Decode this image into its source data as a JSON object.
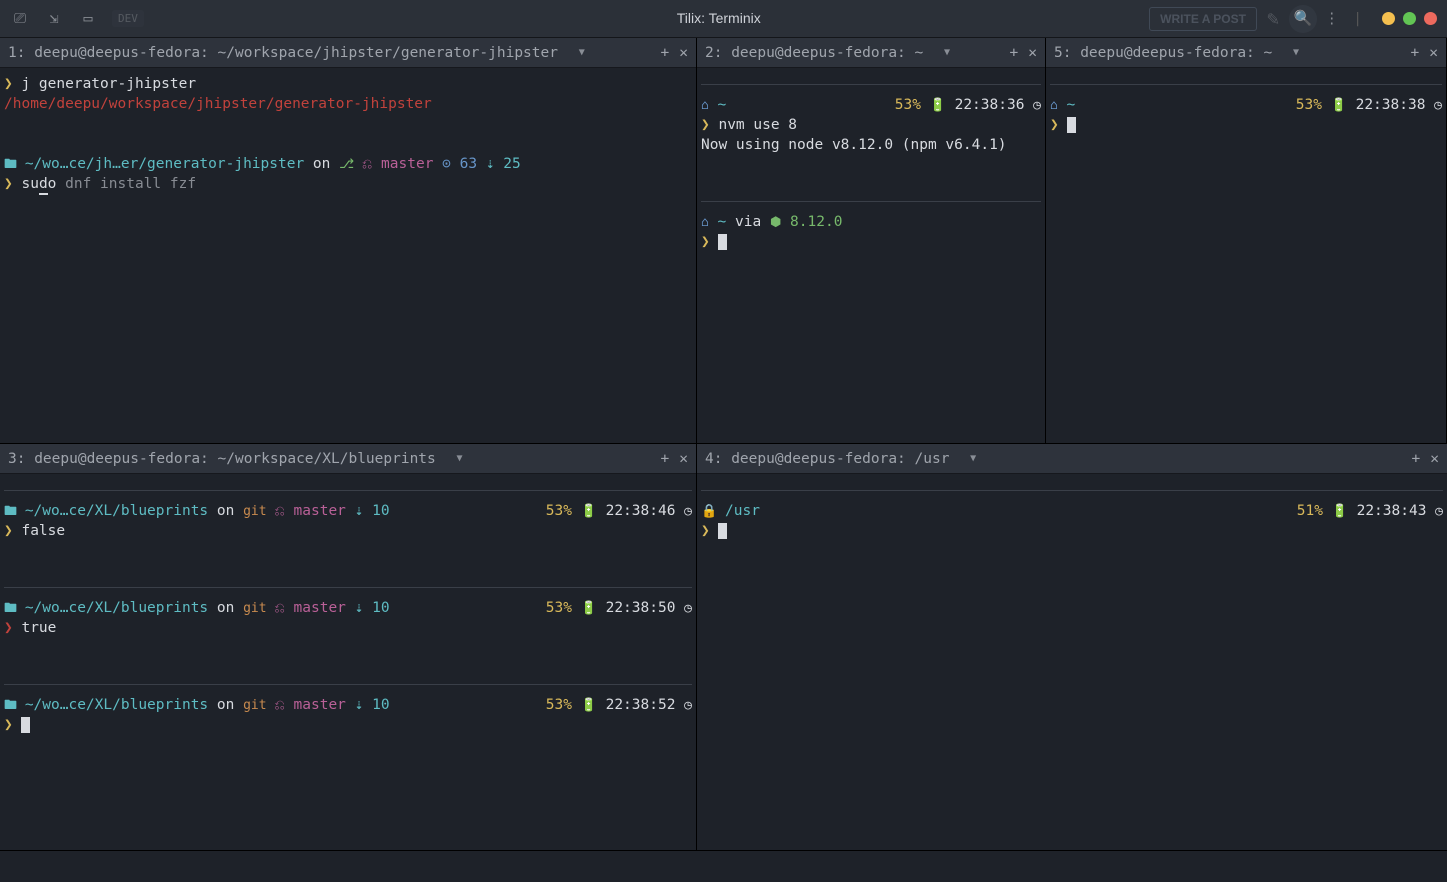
{
  "window": {
    "title": "Tilix: Terminix",
    "behind_button": "WRITE A POST",
    "dev_chip": "DEV"
  },
  "panes": {
    "p1": {
      "tab": "1: deepu@deepus-fedora: ~/workspace/jhipster/generator-jhipster",
      "cmd1": "j generator-jhipster",
      "path": "/home/deepu/workspace/jhipster/generator-jhipster",
      "pwd": "~/wo…ce/jh…er/generator-jhipster",
      "on": " on ",
      "branch": " master",
      "stash": " 63 ",
      "behind": " 25",
      "cmd2_a": "su",
      "cmd2_b": "d",
      "cmd2_c": "o",
      "cmd2_rest": " dnf install fzf"
    },
    "p2": {
      "tab": "2: deepu@deepus-fedora: ~",
      "home": " ~",
      "bat": "53%",
      "time": "22:38:36",
      "cmd": "nvm use 8",
      "out": "Now using node v8.12.0 (npm v6.4.1)",
      "via": " via ",
      "node": " 8.12.0"
    },
    "p5": {
      "tab": "5: deepu@deepus-fedora: ~",
      "home": " ~",
      "bat": "53%",
      "time": "22:38:38"
    },
    "p3": {
      "tab": "3: deepu@deepus-fedora: ~/workspace/XL/blueprints",
      "pwd": "~/wo…ce/XL/blueprints",
      "on": " on ",
      "branch": " master",
      "behind": " 10",
      "r1": {
        "bat": "53%",
        "time": "22:38:46",
        "cmd": "false"
      },
      "r2": {
        "bat": "53%",
        "time": "22:38:50",
        "cmd": "true"
      },
      "r3": {
        "bat": "53%",
        "time": "22:38:52"
      }
    },
    "p4": {
      "tab": "4: deepu@deepus-fedora: /usr",
      "pwd": "/usr",
      "bat": "51%",
      "time": "22:38:43"
    }
  }
}
